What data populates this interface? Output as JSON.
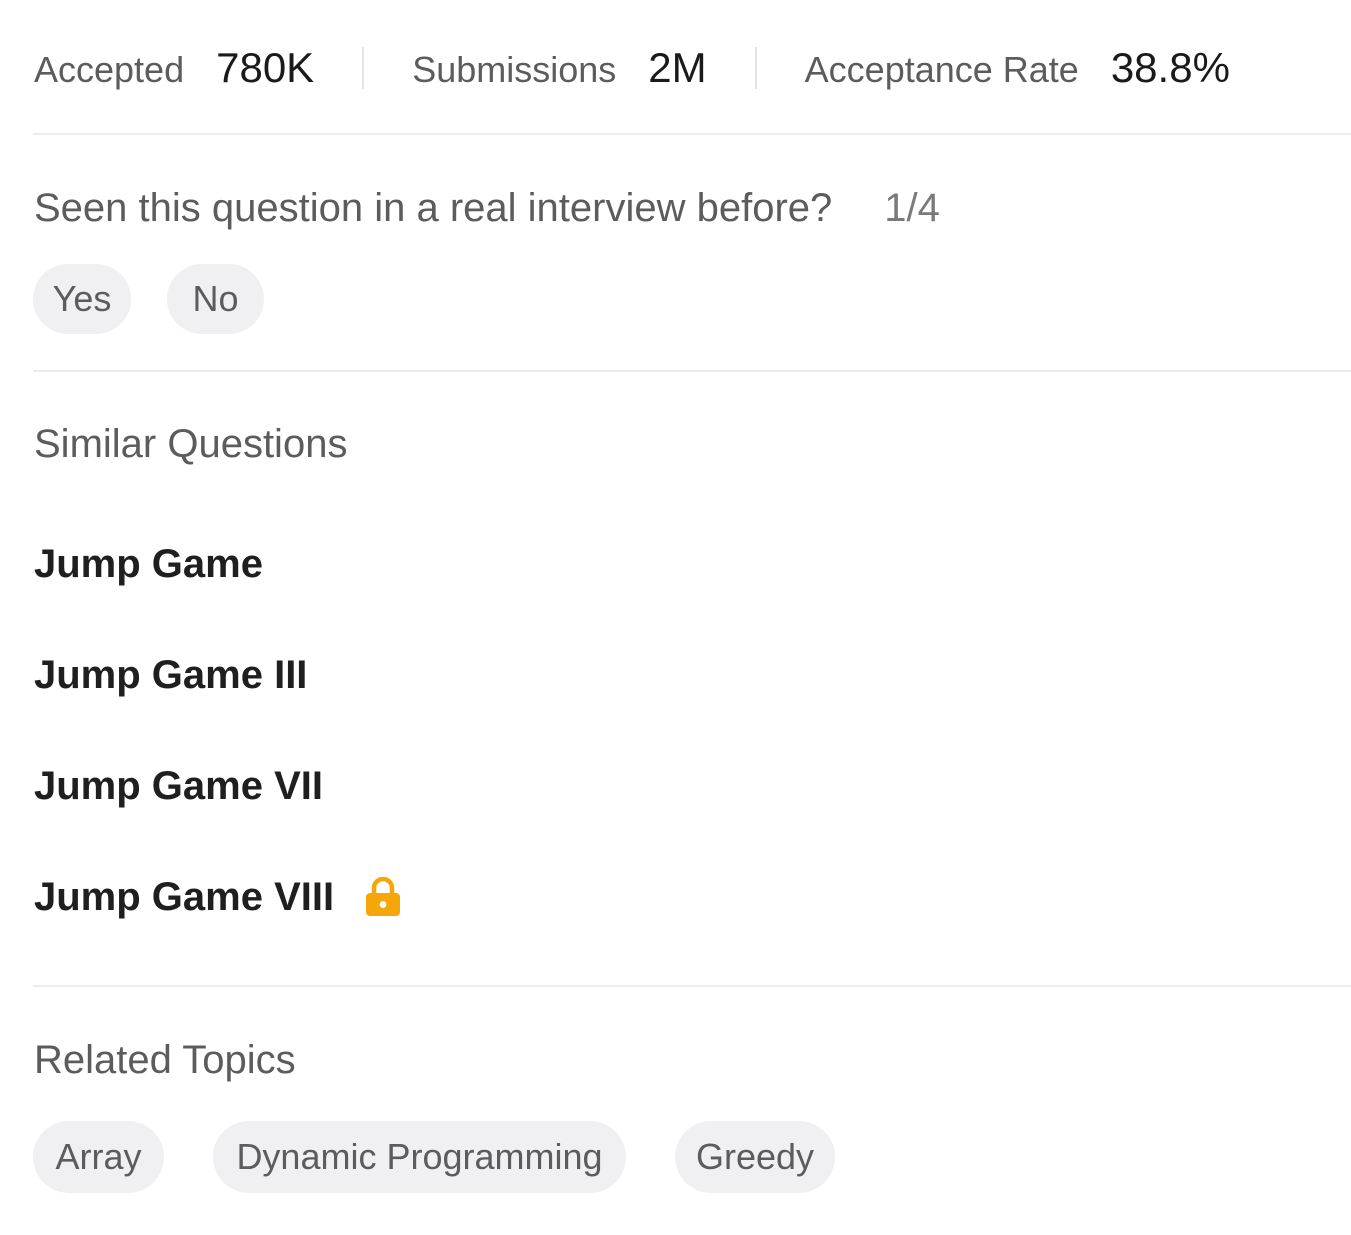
{
  "stats": {
    "accepted_label": "Accepted",
    "accepted_value": "780K",
    "submissions_label": "Submissions",
    "submissions_value": "2M",
    "acceptance_label": "Acceptance Rate",
    "acceptance_value": "38.8%"
  },
  "interview": {
    "question": "Seen this question in a real interview before?",
    "count": "1/4",
    "yes_label": "Yes",
    "no_label": "No"
  },
  "similar": {
    "title": "Similar Questions",
    "items": [
      {
        "label": "Jump Game",
        "locked": false
      },
      {
        "label": "Jump Game III",
        "locked": false
      },
      {
        "label": "Jump Game VII",
        "locked": false
      },
      {
        "label": "Jump Game VIII",
        "locked": true,
        "icon": "lock-icon"
      }
    ]
  },
  "topics": {
    "title": "Related Topics",
    "items": [
      "Array",
      "Dynamic Programming",
      "Greedy"
    ]
  },
  "colors": {
    "lock": "#f5a70a",
    "pill_bg": "#f0f0f2",
    "divider": "#ececec",
    "muted_text": "#5c5c5c",
    "strong_text": "#1f1f1f"
  }
}
